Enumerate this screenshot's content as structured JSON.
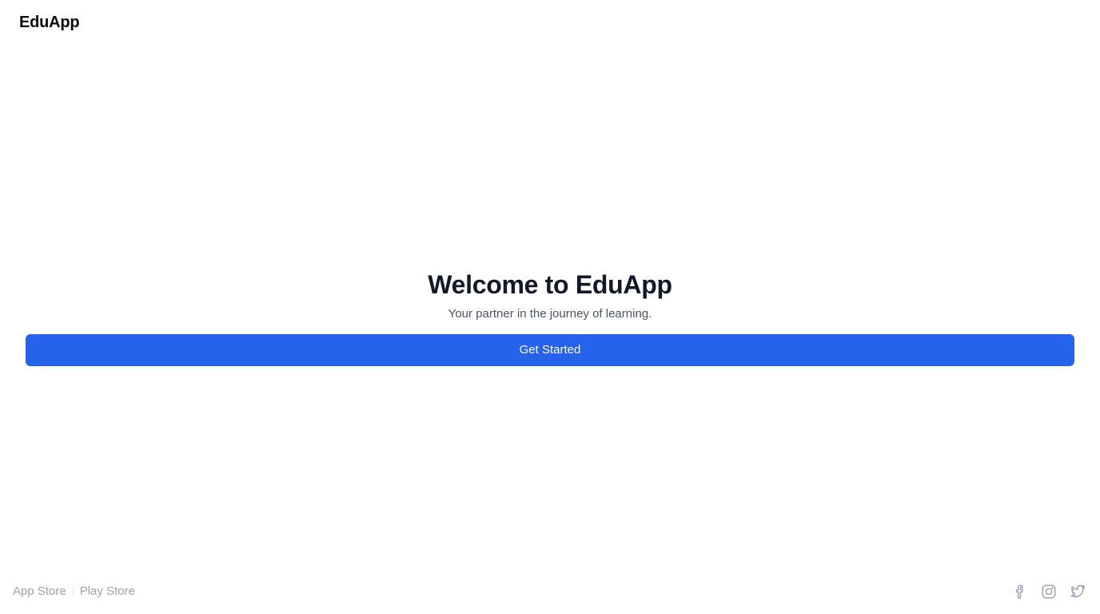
{
  "header": {
    "brand": "EduApp"
  },
  "hero": {
    "title": "Welcome to EduApp",
    "subtitle": "Your partner in the journey of learning.",
    "cta_label": "Get Started"
  },
  "footer": {
    "store_links": [
      "App Store",
      "Play Store"
    ],
    "social_icons": [
      "facebook-icon",
      "instagram-icon",
      "twitter-icon"
    ]
  },
  "colors": {
    "accent": "#2563eb",
    "title": "#111827",
    "subtitle": "#4b5563",
    "muted": "#9ca3af"
  }
}
